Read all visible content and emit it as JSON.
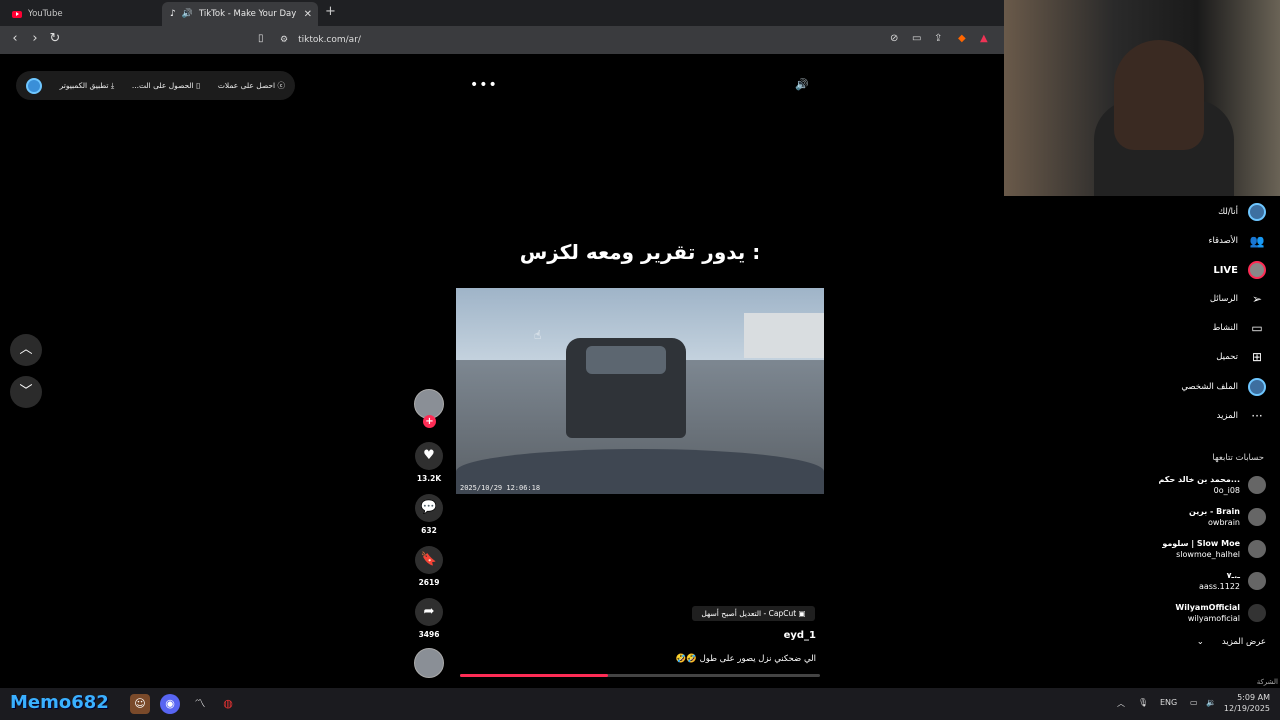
{
  "browser": {
    "tabs": [
      {
        "label": "YouTube"
      },
      {
        "label": "TikTok - Make Your Day"
      }
    ],
    "url": "tiktok.com/ar/"
  },
  "topbar": {
    "coins": "احصل على عملات",
    "app": "الحصول على الت...",
    "desktop": "تطبيق الكمبيوتر"
  },
  "video": {
    "caption": "يدور تقرير ومعه لكزس :",
    "timestamp": "2025/10/29  12:06:18",
    "capcut": "CapCut - التعديل أصبح أسهل",
    "author": "eyd_1",
    "description": "الي ضحكني نزل يصور على طول 🤣🤣",
    "progress_fraction": 0.41
  },
  "actions": {
    "likes": "13.2K",
    "comments": "632",
    "saves": "2619",
    "shares": "3496"
  },
  "sidebar": {
    "items": [
      {
        "label": "أنا/لك",
        "icon": "for-you-icon"
      },
      {
        "label": "الأصدقاء",
        "icon": "friends-icon"
      },
      {
        "label": "LIVE",
        "icon": "live-icon"
      },
      {
        "label": "الرسائل",
        "icon": "messages-icon"
      },
      {
        "label": "النشاط",
        "icon": "activity-icon"
      },
      {
        "label": "تحميل",
        "icon": "upload-icon"
      },
      {
        "label": "الملف الشخصي",
        "icon": "profile-icon"
      },
      {
        "label": "المزيد",
        "icon": "more-icon"
      }
    ],
    "following_header": "حسابات تتابعها",
    "following": [
      {
        "name": "محمد بن خالد حكم...",
        "handle": "0o_i08"
      },
      {
        "name": "برين - Brain",
        "handle": "owbrain"
      },
      {
        "name": "سلومو | Slow Moe",
        "handle": "slowmoe_halhel"
      },
      {
        "name": "ـ.ـ٧",
        "handle": "aass.1122"
      },
      {
        "name": "WilyamOfficial",
        "handle": "wilyamoficial"
      }
    ],
    "see_more": "عرض المزيد",
    "footer": "الشركة"
  },
  "taskbar": {
    "memo": "Memo682",
    "lang": "ENG",
    "time": "5:09 AM",
    "date": "12/19/2025"
  }
}
